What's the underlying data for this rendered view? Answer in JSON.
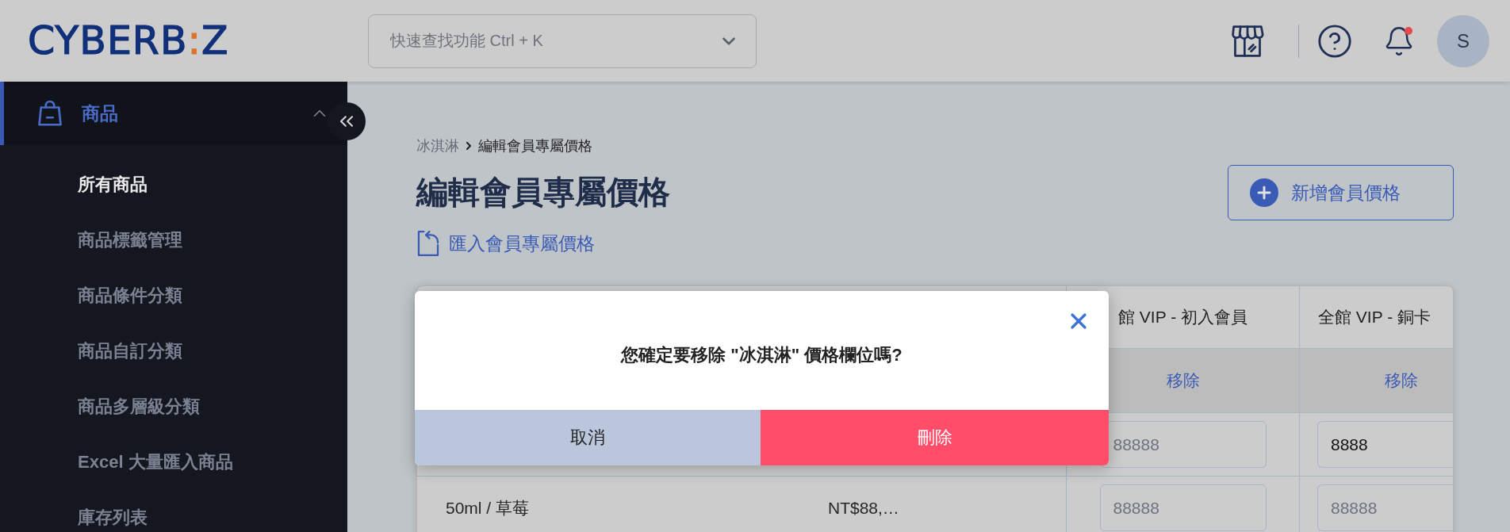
{
  "header": {
    "logo": [
      {
        "text": "CYBERB",
        "accent": false
      },
      {
        "text": ":",
        "accent": true
      },
      {
        "text": "Z",
        "accent": false
      }
    ],
    "search": {
      "placeholder": "快速查找功能 Ctrl + K"
    },
    "notification_dot": true,
    "avatar": {
      "initial": "S"
    }
  },
  "sidebar": {
    "sections": [
      {
        "label": "商品",
        "active": true,
        "expanded": true,
        "children": [
          {
            "label": "所有商品",
            "selected": true
          },
          {
            "label": "商品標籤管理",
            "selected": false
          },
          {
            "label": "商品條件分類",
            "selected": false
          },
          {
            "label": "商品自訂分類",
            "selected": false
          },
          {
            "label": "商品多層級分類",
            "selected": false
          },
          {
            "label": "Excel 大量匯入商品",
            "selected": false
          },
          {
            "label": "庫存列表",
            "selected": false
          }
        ]
      }
    ]
  },
  "breadcrumb": [
    {
      "label": "冰淇淋",
      "current": false
    },
    {
      "label": "編輯會員專屬價格",
      "current": true
    }
  ],
  "title": "編輯會員專屬價格",
  "import_link": "匯入會員專屬價格",
  "add_button": "新增會員價格",
  "table": {
    "columns": [
      {
        "label": "館 VIP - 初入會員"
      },
      {
        "label": "全館 VIP - 銅卡"
      }
    ],
    "remove_links": [
      "移除",
      "移除"
    ],
    "rows": [
      {
        "prices": [
          {
            "placeholder": "88888"
          },
          {
            "value": "8888"
          }
        ]
      },
      {
        "variant": "50ml / 草莓",
        "price": "NT$88,…",
        "prices": [
          {
            "placeholder": "88888"
          },
          {
            "placeholder": "88888"
          }
        ]
      }
    ]
  },
  "dialog": {
    "message": "您確定要移除 \"冰淇淋\" 價格欄位嗎?",
    "buttons": [
      {
        "label": "取消",
        "kind": "cancel"
      },
      {
        "label": "刪除",
        "kind": "danger"
      }
    ]
  }
}
